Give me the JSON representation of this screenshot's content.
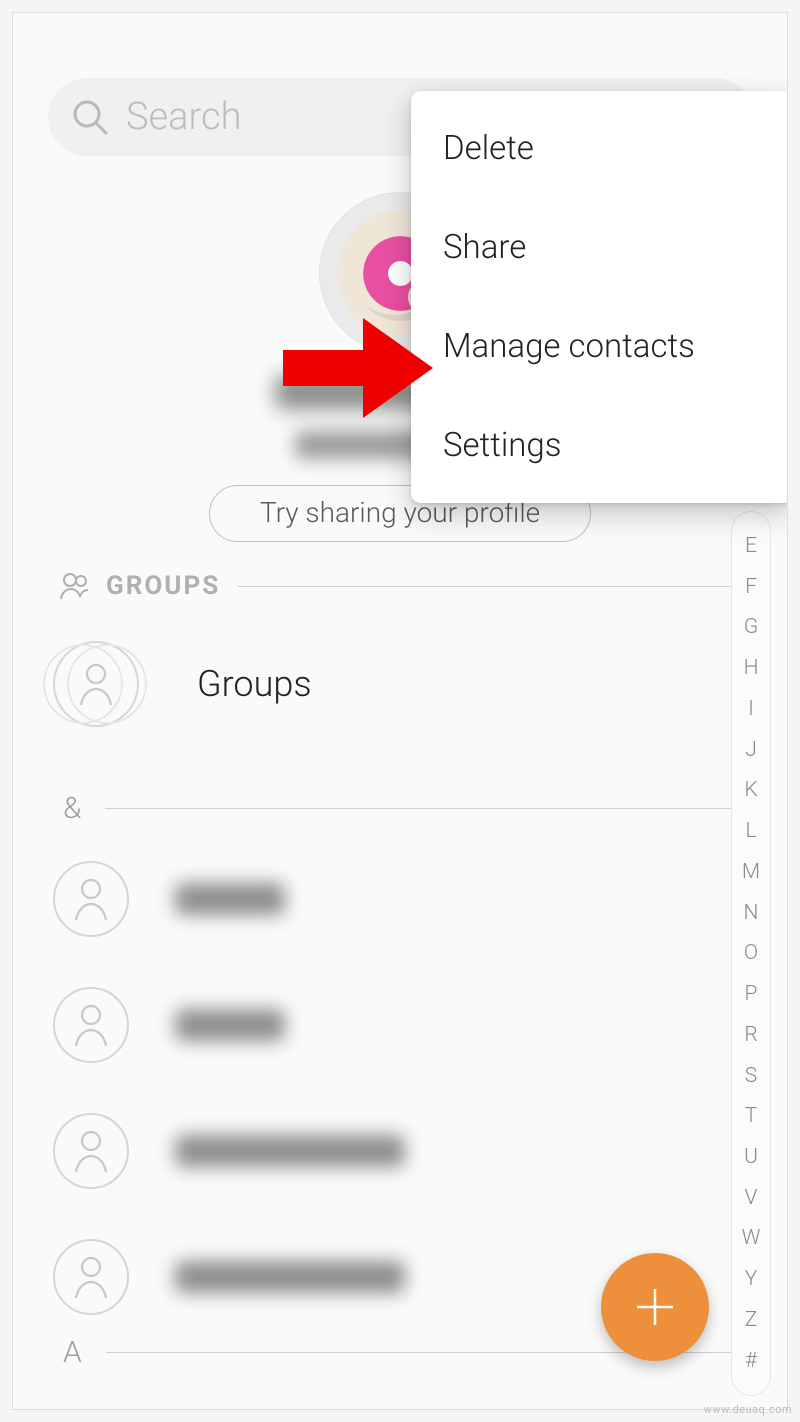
{
  "search": {
    "placeholder": "Search"
  },
  "profile": {
    "share_button": "Try sharing your profile"
  },
  "sections": {
    "groups_label": "GROUPS",
    "groups_row": "Groups",
    "amp_label": "&",
    "a_label": "A"
  },
  "index_letters": [
    "E",
    "F",
    "G",
    "H",
    "I",
    "J",
    "K",
    "L",
    "M",
    "N",
    "O",
    "P",
    "R",
    "S",
    "T",
    "U",
    "V",
    "W",
    "Y",
    "Z",
    "#"
  ],
  "menu": {
    "delete": "Delete",
    "share": "Share",
    "manage": "Manage contacts",
    "settings": "Settings"
  },
  "watermark": "www.deuaq.com"
}
